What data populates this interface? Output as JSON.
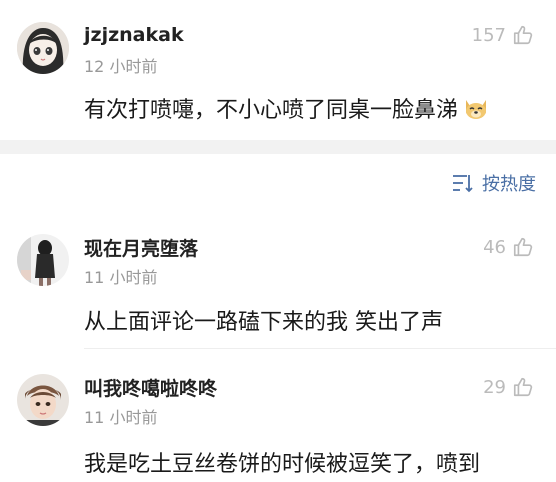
{
  "comments": [
    {
      "username": "jzjznakak",
      "time": "12 小时前",
      "likes": "157",
      "content": "有次打喷嚏，不小心喷了同桌一脸鼻涕",
      "emoji": "doge-emoji"
    },
    {
      "username": "现在月亮堕落",
      "time": "11 小时前",
      "likes": "46",
      "content": "从上面评论一路磕下来的我 笑出了声"
    },
    {
      "username": "叫我咚噶啦咚咚",
      "time": "11 小时前",
      "likes": "29",
      "content": "我是吃土豆丝卷饼的时候被逗笑了，喷到"
    }
  ],
  "sort": {
    "label": "按热度"
  },
  "colors": {
    "accent": "#4a6fa5",
    "muted": "#999999",
    "like": "#bbbbbb"
  }
}
